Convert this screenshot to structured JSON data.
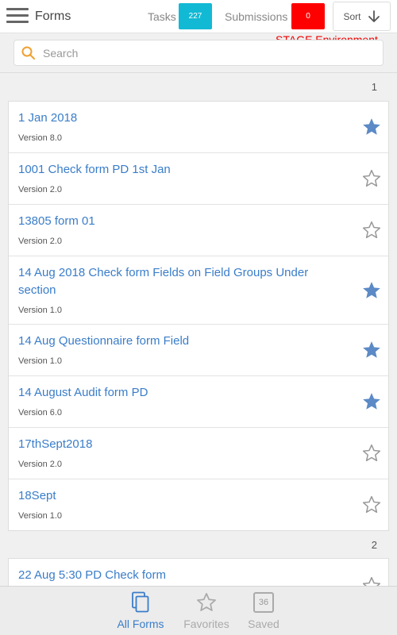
{
  "header": {
    "title": "Forms",
    "tasks_label": "Tasks",
    "tasks_count": "227",
    "submissions_label": "Submissions",
    "submissions_count": "0",
    "sort_label": "Sort",
    "environment": "STAGE Environment",
    "colors": {
      "tasks_badge": "#12b9d4",
      "submissions_badge": "#ff0000",
      "environment": "#e00000"
    }
  },
  "search": {
    "placeholder": "Search",
    "value": ""
  },
  "pages": [
    {
      "number": "1",
      "items": [
        {
          "title": "1 Jan 2018",
          "version": "Version 8.0",
          "favorite": true
        },
        {
          "title": "1001 Check form PD 1st Jan",
          "version": "Version 2.0",
          "favorite": false
        },
        {
          "title": "13805 form 01",
          "version": "Version 2.0",
          "favorite": false
        },
        {
          "title": "14 Aug 2018 Check form  Fields on Field Groups Under section",
          "version": "Version 1.0",
          "favorite": true
        },
        {
          "title": "14 Aug Questionnaire form Field",
          "version": "Version 1.0",
          "favorite": true
        },
        {
          "title": "14 August Audit form PD",
          "version": "Version 6.0",
          "favorite": true
        },
        {
          "title": "17thSept2018",
          "version": "Version 2.0",
          "favorite": false
        },
        {
          "title": "18Sept",
          "version": "Version 1.0",
          "favorite": false
        }
      ]
    },
    {
      "number": "2",
      "items": [
        {
          "title": "22 Aug 5:30 PD Check form",
          "favorite": false
        }
      ]
    }
  ],
  "bottom_nav": {
    "all_forms": "All Forms",
    "favorites": "Favorites",
    "saved": "Saved",
    "saved_count": "36"
  },
  "icons": {
    "menu": "hamburger-icon",
    "sort": "arrow-down-icon",
    "search": "search-icon",
    "favorite_on": "star-filled-icon",
    "favorite_off": "star-outline-icon",
    "all_forms": "documents-icon",
    "favorites": "star-outline-icon",
    "saved": "saved-box-icon"
  }
}
